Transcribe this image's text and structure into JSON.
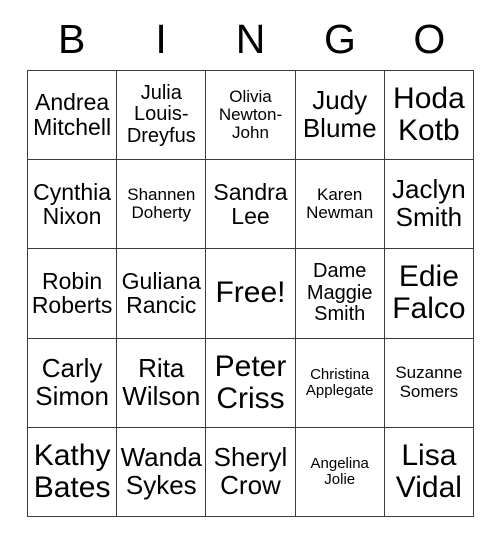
{
  "card": {
    "title": "BINGO",
    "header_letters": [
      "B",
      "I",
      "N",
      "G",
      "O"
    ],
    "colors": {
      "background": "#ffffff",
      "text": "#000000",
      "border": "#3b3b3b"
    },
    "free_space_label": "Free!",
    "free_space_position": {
      "row": 3,
      "column": 3
    },
    "columns": 5,
    "rows": 5,
    "cells": [
      [
        {
          "name": "Andrea\nMitchell",
          "size": "lg"
        },
        {
          "name": "Julia\nLouis-\nDreyfus",
          "size": "md"
        },
        {
          "name": "Olivia\nNewton-\nJohn",
          "size": "sm"
        },
        {
          "name": "Judy\nBlume",
          "size": "xl"
        },
        {
          "name": "Hoda\nKotb",
          "size": "xxl"
        }
      ],
      [
        {
          "name": "Cynthia\nNixon",
          "size": "lg"
        },
        {
          "name": "Shannen\nDoherty",
          "size": "sm"
        },
        {
          "name": "Sandra\nLee",
          "size": "lg"
        },
        {
          "name": "Karen\nNewman",
          "size": "sm"
        },
        {
          "name": "Jaclyn\nSmith",
          "size": "xl"
        }
      ],
      [
        {
          "name": "Robin\nRoberts",
          "size": "lg"
        },
        {
          "name": "Guliana\nRancic",
          "size": "lg"
        },
        {
          "name": "Free!",
          "size": "xxl",
          "free": true
        },
        {
          "name": "Dame\nMaggie\nSmith",
          "size": "md"
        },
        {
          "name": "Edie\nFalco",
          "size": "xxl"
        }
      ],
      [
        {
          "name": "Carly\nSimon",
          "size": "xl"
        },
        {
          "name": "Rita\nWilson",
          "size": "xl"
        },
        {
          "name": "Peter\nCriss",
          "size": "xxl"
        },
        {
          "name": "Christina\nApplegate",
          "size": "xs"
        },
        {
          "name": "Suzanne\nSomers",
          "size": "sm"
        }
      ],
      [
        {
          "name": "Kathy\nBates",
          "size": "xxl"
        },
        {
          "name": "Wanda\nSykes",
          "size": "xl"
        },
        {
          "name": "Sheryl\nCrow",
          "size": "xl"
        },
        {
          "name": "Angelina\nJolie",
          "size": "xs"
        },
        {
          "name": "Lisa\nVidal",
          "size": "xxl"
        }
      ]
    ]
  }
}
